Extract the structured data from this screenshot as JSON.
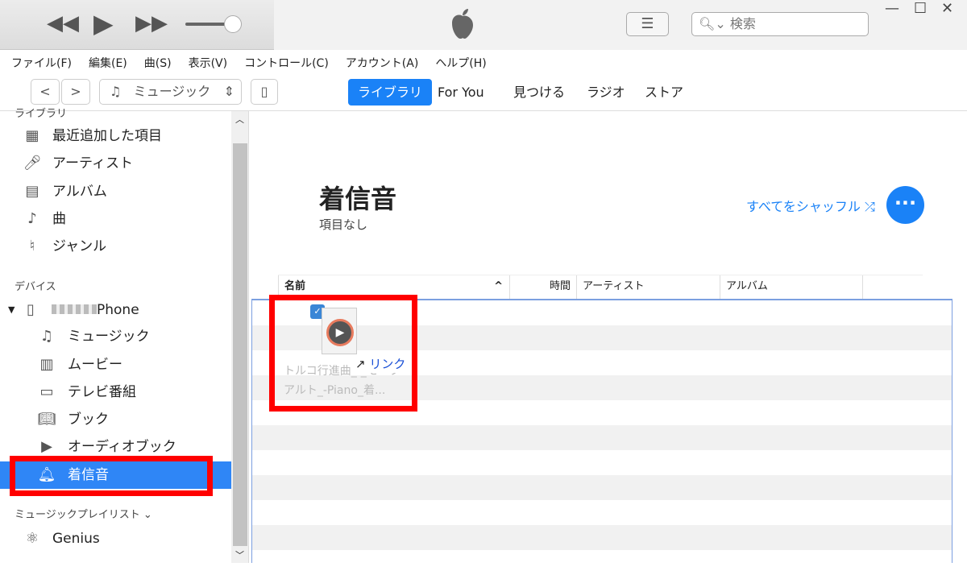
{
  "player": {
    "rewind_icon": "rewind-icon",
    "play_icon": "play-icon",
    "forward_icon": "fast-forward-icon",
    "volume": 0.8
  },
  "search": {
    "placeholder": "検索"
  },
  "menu": [
    "ファイル(F)",
    "編集(E)",
    "曲(S)",
    "表示(V)",
    "コントロール(C)",
    "アカウント(A)",
    "ヘルプ(H)"
  ],
  "toolbar": {
    "media": "ミュージック",
    "tabs": [
      "ライブラリ",
      "For You",
      "見つける",
      "ラジオ",
      "ストア"
    ],
    "active_tab": "ライブラリ"
  },
  "sidebar": {
    "library_header": "ライブラリ",
    "library": [
      "最近追加した項目",
      "アーティスト",
      "アルバム",
      "曲",
      "ジャンル"
    ],
    "devices_header": "デバイス",
    "device": "Phone",
    "device_items": [
      "ミュージック",
      "ムービー",
      "テレビ番組",
      "ブック",
      "オーディオブック",
      "着信音"
    ],
    "selected": "着信音",
    "playlists_header": "ミュージックプレイリスト ⌄",
    "playlists": [
      "Genius"
    ]
  },
  "main": {
    "title": "着信音",
    "subtitle": "項目なし",
    "shuffle": "すべてをシャッフル",
    "columns": [
      "名前",
      "時間",
      "アーティスト",
      "アルバム"
    ],
    "drag": {
      "file_name_1": "トルコ行進曲_-_モーツ",
      "file_name_2": "アルト_-Piano_着...",
      "link_label": "リンク"
    }
  }
}
